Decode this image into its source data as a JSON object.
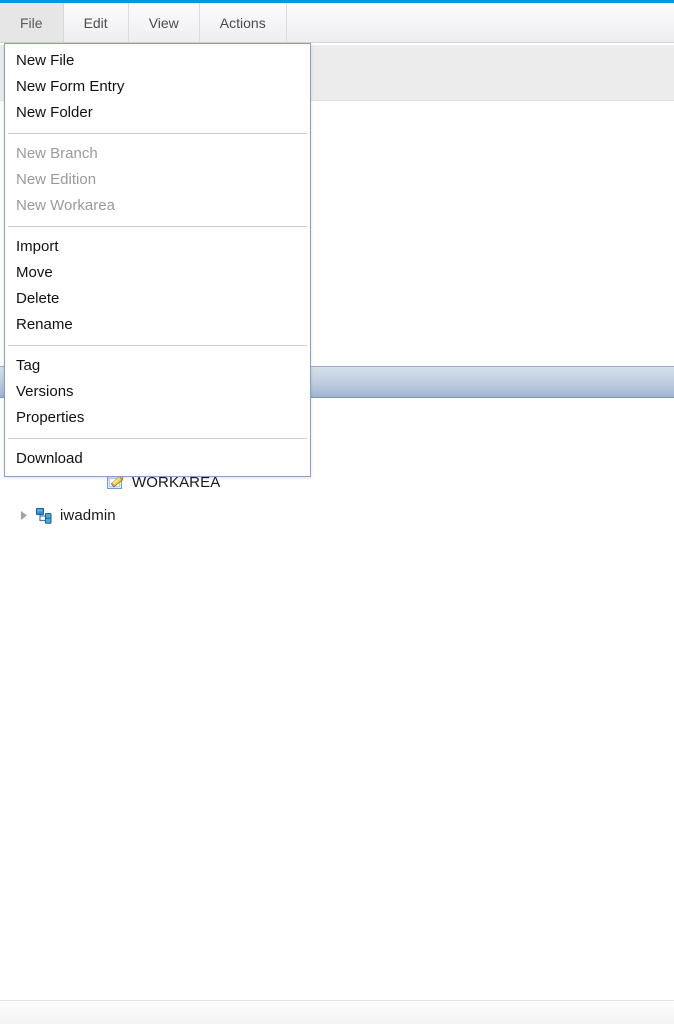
{
  "theme": {
    "accent_blue": "#0099dd",
    "menu_border": "#8ba0c0",
    "selected_row_top": "#d6dfeb",
    "selected_row_bottom": "#9fb4d0",
    "disabled_text": "#9a9a9a",
    "toolbar_bg": "#ececec"
  },
  "menubar": {
    "tabs": [
      {
        "label": "File",
        "active": true
      },
      {
        "label": "Edit",
        "active": false
      },
      {
        "label": "View",
        "active": false
      },
      {
        "label": "Actions",
        "active": false
      }
    ]
  },
  "file_menu": {
    "groups": [
      {
        "items": [
          {
            "label": "New File",
            "disabled": false
          },
          {
            "label": "New Form Entry",
            "disabled": false
          },
          {
            "label": "New Folder",
            "disabled": false
          }
        ]
      },
      {
        "items": [
          {
            "label": "New Branch",
            "disabled": true
          },
          {
            "label": "New Edition",
            "disabled": true
          },
          {
            "label": "New Workarea",
            "disabled": true
          }
        ]
      },
      {
        "items": [
          {
            "label": "Import",
            "disabled": false
          },
          {
            "label": "Move",
            "disabled": false
          },
          {
            "label": "Delete",
            "disabled": false
          },
          {
            "label": "Rename",
            "disabled": false
          }
        ]
      },
      {
        "items": [
          {
            "label": "Tag",
            "disabled": false
          },
          {
            "label": "Versions",
            "disabled": false
          },
          {
            "label": "Properties",
            "disabled": false
          }
        ]
      },
      {
        "items": [
          {
            "label": "Download",
            "disabled": false
          }
        ]
      }
    ]
  },
  "tree": {
    "rows": [
      {
        "label": "WORKAREA",
        "icon": "workarea-pencil-icon",
        "indent": 3,
        "expander": "none"
      },
      {
        "label": "iwadmin",
        "icon": "branch-node-icon",
        "indent": 1,
        "expander": "collapsed"
      }
    ]
  }
}
